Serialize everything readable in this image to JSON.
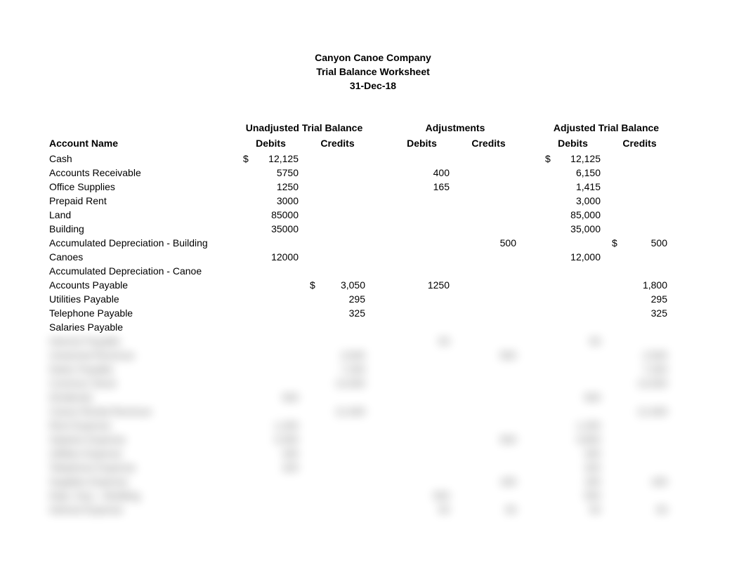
{
  "header": {
    "company": "Canyon Canoe Company",
    "title": "Trial Balance Worksheet",
    "date": "31-Dec-18"
  },
  "sections": {
    "unadjusted": "Unadjusted Trial Balance",
    "adjustments": "Adjustments",
    "adjusted": "Adjusted Trial Balance"
  },
  "columns": {
    "account": "Account Name",
    "debits": "Debits",
    "credits": "Credits"
  },
  "rows": [
    {
      "acct": "Cash",
      "uD": "12,125",
      "uDsym": "$",
      "aD": "12,125",
      "aDsym": "$"
    },
    {
      "acct": "Accounts Receivable",
      "uD": "5750",
      "jD": "400",
      "aD": "6,150"
    },
    {
      "acct": "Office Supplies",
      "uD": "1250",
      "jD": "165",
      "aD": "1,415"
    },
    {
      "acct": "Prepaid Rent",
      "uD": "3000",
      "aD": "3,000"
    },
    {
      "acct": "Land",
      "uD": "85000",
      "aD": "85,000"
    },
    {
      "acct": "Building",
      "uD": "35000",
      "aD": "35,000"
    },
    {
      "acct": "Accumulated Depreciation - Building",
      "jC": "500",
      "aC": "500",
      "aCsym": "$"
    },
    {
      "acct": "Canoes",
      "uD": "12000",
      "aD": "12,000"
    },
    {
      "acct": "Accumulated Depreciation - Canoe"
    },
    {
      "acct": "Accounts Payable",
      "uC": "3,050",
      "uCsym": "$",
      "jD": "1250",
      "aC": "1,800"
    },
    {
      "acct": "Utilities Payable",
      "uC": "295",
      "aC": "295"
    },
    {
      "acct": "Telephone Payable",
      "uC": "325",
      "aC": "325"
    },
    {
      "acct": "Salaries Payable"
    }
  ],
  "blurRows": [
    {
      "acct": "Interest Payable",
      "jD": "50",
      "aD": "50"
    },
    {
      "acct": "Unearned Revenue",
      "uC": "3,000",
      "jC": "500",
      "aC": "2,500"
    },
    {
      "acct": "Notes Payable",
      "uC": "7,200",
      "aC": "7,200"
    },
    {
      "acct": "Common Stock",
      "uC": "13,000",
      "aC": "13,000"
    },
    {
      "acct": "Dividends",
      "uD": "500",
      "aD": "500"
    },
    {
      "acct": "Canoe Rental Revenue",
      "uC": "12,400",
      "aC": "12,400"
    },
    {
      "acct": "Rent Expense",
      "uD": "1,200",
      "aD": "1,200"
    },
    {
      "acct": "Salaries Expense",
      "uD": "3,300",
      "jC": "500",
      "aD": "3,800"
    },
    {
      "acct": "Utilities Expense",
      "uD": "445",
      "aD": "445"
    },
    {
      "acct": "Telephone Expense",
      "uD": "325",
      "aD": "325"
    },
    {
      "acct": "Supplies Expense",
      "jC": "165",
      "aD": "165",
      "aCsym": "$",
      "aC": "165"
    },
    {
      "acct": "Depr. Exp.—Building",
      "jD": "500",
      "aD": "500"
    },
    {
      "acct": "Interest Expense",
      "jD": "50",
      "aD": "50",
      "jC": "50",
      "aC": "50"
    }
  ]
}
